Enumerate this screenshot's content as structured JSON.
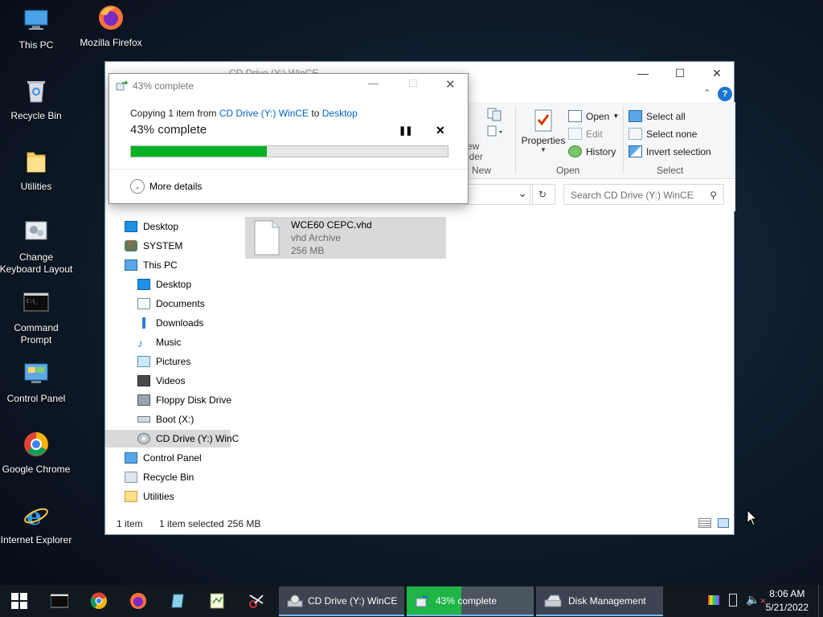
{
  "desktop": {
    "icons": [
      {
        "label": "This PC",
        "icon": "this-pc-icon"
      },
      {
        "label": "Mozilla Firefox",
        "icon": "firefox-icon"
      },
      {
        "label": "Recycle Bin",
        "icon": "recycle-bin-icon"
      },
      {
        "label": "Utilities",
        "icon": "folder-icon"
      },
      {
        "label": "Change Keyboard Layout",
        "icon": "keyboard-layout-icon"
      },
      {
        "label": "Command Prompt",
        "icon": "command-prompt-icon"
      },
      {
        "label": "Control Panel",
        "icon": "control-panel-icon"
      },
      {
        "label": "Google Chrome",
        "icon": "chrome-icon"
      },
      {
        "label": "Internet Explorer",
        "icon": "internet-explorer-icon"
      }
    ]
  },
  "explorer": {
    "title": "CD Drive (Y:) WinCE",
    "ribbon": {
      "new_label_fragment1": "ew",
      "new_label_fragment2": "lder",
      "group_new": "New",
      "properties": "Properties",
      "open": "Open",
      "edit": "Edit",
      "history": "History",
      "group_open": "Open",
      "select_all": "Select all",
      "select_none": "Select none",
      "invert_selection": "Invert selection",
      "group_select": "Select"
    },
    "search_placeholder": "Search CD Drive (Y:) WinCE",
    "nav": [
      {
        "label": "Desktop",
        "icon": "desktop-icon",
        "indent": 0
      },
      {
        "label": "SYSTEM",
        "icon": "user-icon",
        "indent": 0
      },
      {
        "label": "This PC",
        "icon": "this-pc-icon",
        "indent": 0
      },
      {
        "label": "Desktop",
        "icon": "desktop-icon",
        "indent": 1
      },
      {
        "label": "Documents",
        "icon": "documents-icon",
        "indent": 1
      },
      {
        "label": "Downloads",
        "icon": "downloads-icon",
        "indent": 1
      },
      {
        "label": "Music",
        "icon": "music-icon",
        "indent": 1
      },
      {
        "label": "Pictures",
        "icon": "pictures-icon",
        "indent": 1
      },
      {
        "label": "Videos",
        "icon": "videos-icon",
        "indent": 1
      },
      {
        "label": "Floppy Disk Drive",
        "icon": "floppy-drive-icon",
        "indent": 1
      },
      {
        "label": "Boot (X:)",
        "icon": "drive-icon",
        "indent": 1
      },
      {
        "label": "CD Drive (Y:) WinC",
        "icon": "cd-drive-icon",
        "indent": 1
      },
      {
        "label": "Control Panel",
        "icon": "control-panel-icon",
        "indent": 0
      },
      {
        "label": "Recycle Bin",
        "icon": "recycle-bin-icon",
        "indent": 0
      },
      {
        "label": "Utilities",
        "icon": "folder-icon",
        "indent": 0
      }
    ],
    "file": {
      "name": "WCE60 CEPC.vhd",
      "type": "vhd Archive",
      "size": "256 MB"
    },
    "status": {
      "count": "1 item",
      "selected": "1 item selected",
      "size": "256 MB"
    }
  },
  "dialog": {
    "title": "43% complete",
    "copy_prefix": "Copying 1 item from ",
    "source": "CD Drive (Y:) WinCE",
    "to": " to ",
    "dest": "Desktop",
    "progress_text": "43% complete",
    "progress": 0.43,
    "more_details": "More details"
  },
  "taskbar": {
    "tasks": [
      {
        "label": "CD Drive (Y:) WinCE",
        "icon": "cd-drive-icon"
      },
      {
        "label": "43% complete",
        "icon": "copy-progress-icon"
      },
      {
        "label": "Disk Management",
        "icon": "disk-management-icon"
      }
    ],
    "time": "8:06 AM",
    "date": "5/21/2022"
  },
  "colors": {
    "accent": "#0078d7",
    "progress": "#06b025",
    "link": "#0066cc"
  }
}
